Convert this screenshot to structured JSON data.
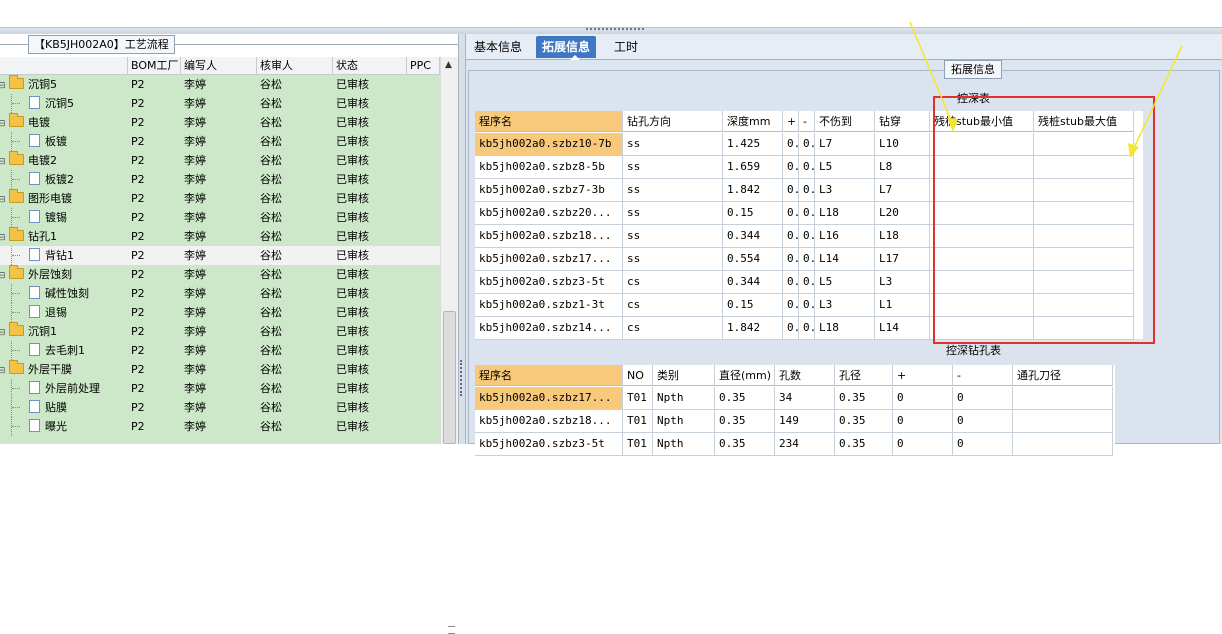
{
  "left_panel": {
    "title": "【KB5JH002A0】工艺流程",
    "columns": [
      "BOM工厂",
      "编写人",
      "核审人",
      "状态",
      "PPC"
    ],
    "rows": [
      {
        "name": "沉铜5",
        "kind": "folder",
        "bom": "P2",
        "author": "李婷",
        "reviewer": "谷松",
        "status": "已审核"
      },
      {
        "name": "沉铜5",
        "kind": "doc",
        "bom": "P2",
        "author": "李婷",
        "reviewer": "谷松",
        "status": "已审核"
      },
      {
        "name": "电镀",
        "kind": "folder",
        "bom": "P2",
        "author": "李婷",
        "reviewer": "谷松",
        "status": "已审核"
      },
      {
        "name": "板镀",
        "kind": "doc",
        "bom": "P2",
        "author": "李婷",
        "reviewer": "谷松",
        "status": "已审核"
      },
      {
        "name": "电镀2",
        "kind": "folder",
        "bom": "P2",
        "author": "李婷",
        "reviewer": "谷松",
        "status": "已审核"
      },
      {
        "name": "板镀2",
        "kind": "doc",
        "bom": "P2",
        "author": "李婷",
        "reviewer": "谷松",
        "status": "已审核"
      },
      {
        "name": "图形电镀",
        "kind": "folder",
        "bom": "P2",
        "author": "李婷",
        "reviewer": "谷松",
        "status": "已审核"
      },
      {
        "name": "镀锡",
        "kind": "doc",
        "bom": "P2",
        "author": "李婷",
        "reviewer": "谷松",
        "status": "已审核"
      },
      {
        "name": "钻孔1",
        "kind": "folder",
        "bom": "P2",
        "author": "李婷",
        "reviewer": "谷松",
        "status": "已审核"
      },
      {
        "name": "背钻1",
        "kind": "doc",
        "bom": "P2",
        "author": "李婷",
        "reviewer": "谷松",
        "status": "已审核",
        "selected": true
      },
      {
        "name": "外层蚀刻",
        "kind": "folder",
        "bom": "P2",
        "author": "李婷",
        "reviewer": "谷松",
        "status": "已审核"
      },
      {
        "name": "碱性蚀刻",
        "kind": "doc",
        "bom": "P2",
        "author": "李婷",
        "reviewer": "谷松",
        "status": "已审核"
      },
      {
        "name": "退锡",
        "kind": "doc",
        "bom": "P2",
        "author": "李婷",
        "reviewer": "谷松",
        "status": "已审核"
      },
      {
        "name": "沉铜1",
        "kind": "folder",
        "bom": "P2",
        "author": "李婷",
        "reviewer": "谷松",
        "status": "已审核"
      },
      {
        "name": "去毛刺1",
        "kind": "doc",
        "bom": "P2",
        "author": "李婷",
        "reviewer": "谷松",
        "status": "已审核"
      },
      {
        "name": "外层干膜",
        "kind": "folder",
        "bom": "P2",
        "author": "李婷",
        "reviewer": "谷松",
        "status": "已审核"
      },
      {
        "name": "外层前处理",
        "kind": "doc",
        "bom": "P2",
        "author": "李婷",
        "reviewer": "谷松",
        "status": "已审核"
      },
      {
        "name": "贴膜",
        "kind": "doc",
        "bom": "P2",
        "author": "李婷",
        "reviewer": "谷松",
        "status": "已审核"
      },
      {
        "name": "曝光",
        "kind": "doc",
        "bom": "P2",
        "author": "李婷",
        "reviewer": "谷松",
        "status": "已审核"
      }
    ]
  },
  "tabs": [
    "基本信息",
    "拓展信息",
    "工时"
  ],
  "active_tab": 1,
  "group_title": "拓展信息",
  "depth_table": {
    "title": "控深表",
    "columns": [
      "程序名",
      "钻孔方向",
      "深度mm",
      "+",
      "-",
      "不伤到",
      "钻穿",
      "残桩stub最小值",
      "残桩stub最大值"
    ],
    "rows": [
      [
        "kb5jh002a0.szbz10-7b",
        "ss",
        "1.425",
        "0..",
        "0..",
        "L7",
        "L10",
        "",
        ""
      ],
      [
        "kb5jh002a0.szbz8-5b",
        "ss",
        "1.659",
        "0..",
        "0..",
        "L5",
        "L8",
        "",
        ""
      ],
      [
        "kb5jh002a0.szbz7-3b",
        "ss",
        "1.842",
        "0..",
        "0..",
        "L3",
        "L7",
        "",
        ""
      ],
      [
        "kb5jh002a0.szbz20...",
        "ss",
        "0.15",
        "0..",
        "0..",
        "L18",
        "L20",
        "",
        ""
      ],
      [
        "kb5jh002a0.szbz18...",
        "ss",
        "0.344",
        "0..",
        "0..",
        "L16",
        "L18",
        "",
        ""
      ],
      [
        "kb5jh002a0.szbz17...",
        "ss",
        "0.554",
        "0..",
        "0..",
        "L14",
        "L17",
        "",
        ""
      ],
      [
        "kb5jh002a0.szbz3-5t",
        "cs",
        "0.344",
        "0..",
        "0..",
        "L5",
        "L3",
        "",
        ""
      ],
      [
        "kb5jh002a0.szbz1-3t",
        "cs",
        "0.15",
        "0..",
        "0..",
        "L3",
        "L1",
        "",
        ""
      ],
      [
        "kb5jh002a0.szbz14...",
        "cs",
        "1.842",
        "0..",
        "0..",
        "L18",
        "L14",
        "",
        ""
      ]
    ]
  },
  "hole_table": {
    "title": "控深钻孔表",
    "columns": [
      "程序名",
      "NO",
      "类别",
      "直径(mm)",
      "孔数",
      "孔径",
      "+",
      "-",
      "通孔刀径"
    ],
    "rows": [
      [
        "kb5jh002a0.szbz17...",
        "T01",
        "Npth",
        "0.35",
        "34",
        "0.35",
        "0",
        "0",
        ""
      ],
      [
        "kb5jh002a0.szbz18...",
        "T01",
        "Npth",
        "0.35",
        "149",
        "0.35",
        "0",
        "0",
        ""
      ],
      [
        "kb5jh002a0.szbz3-5t",
        "T01",
        "Npth",
        "0.35",
        "234",
        "0.35",
        "0",
        "0",
        ""
      ]
    ]
  },
  "colors": {
    "tree_bg": "#cde8c8",
    "active_tab": "#3f77c5",
    "highlight_header": "#f8c97a",
    "annotation_box": "#e03030",
    "annotation_arrow": "#f5e62a"
  }
}
